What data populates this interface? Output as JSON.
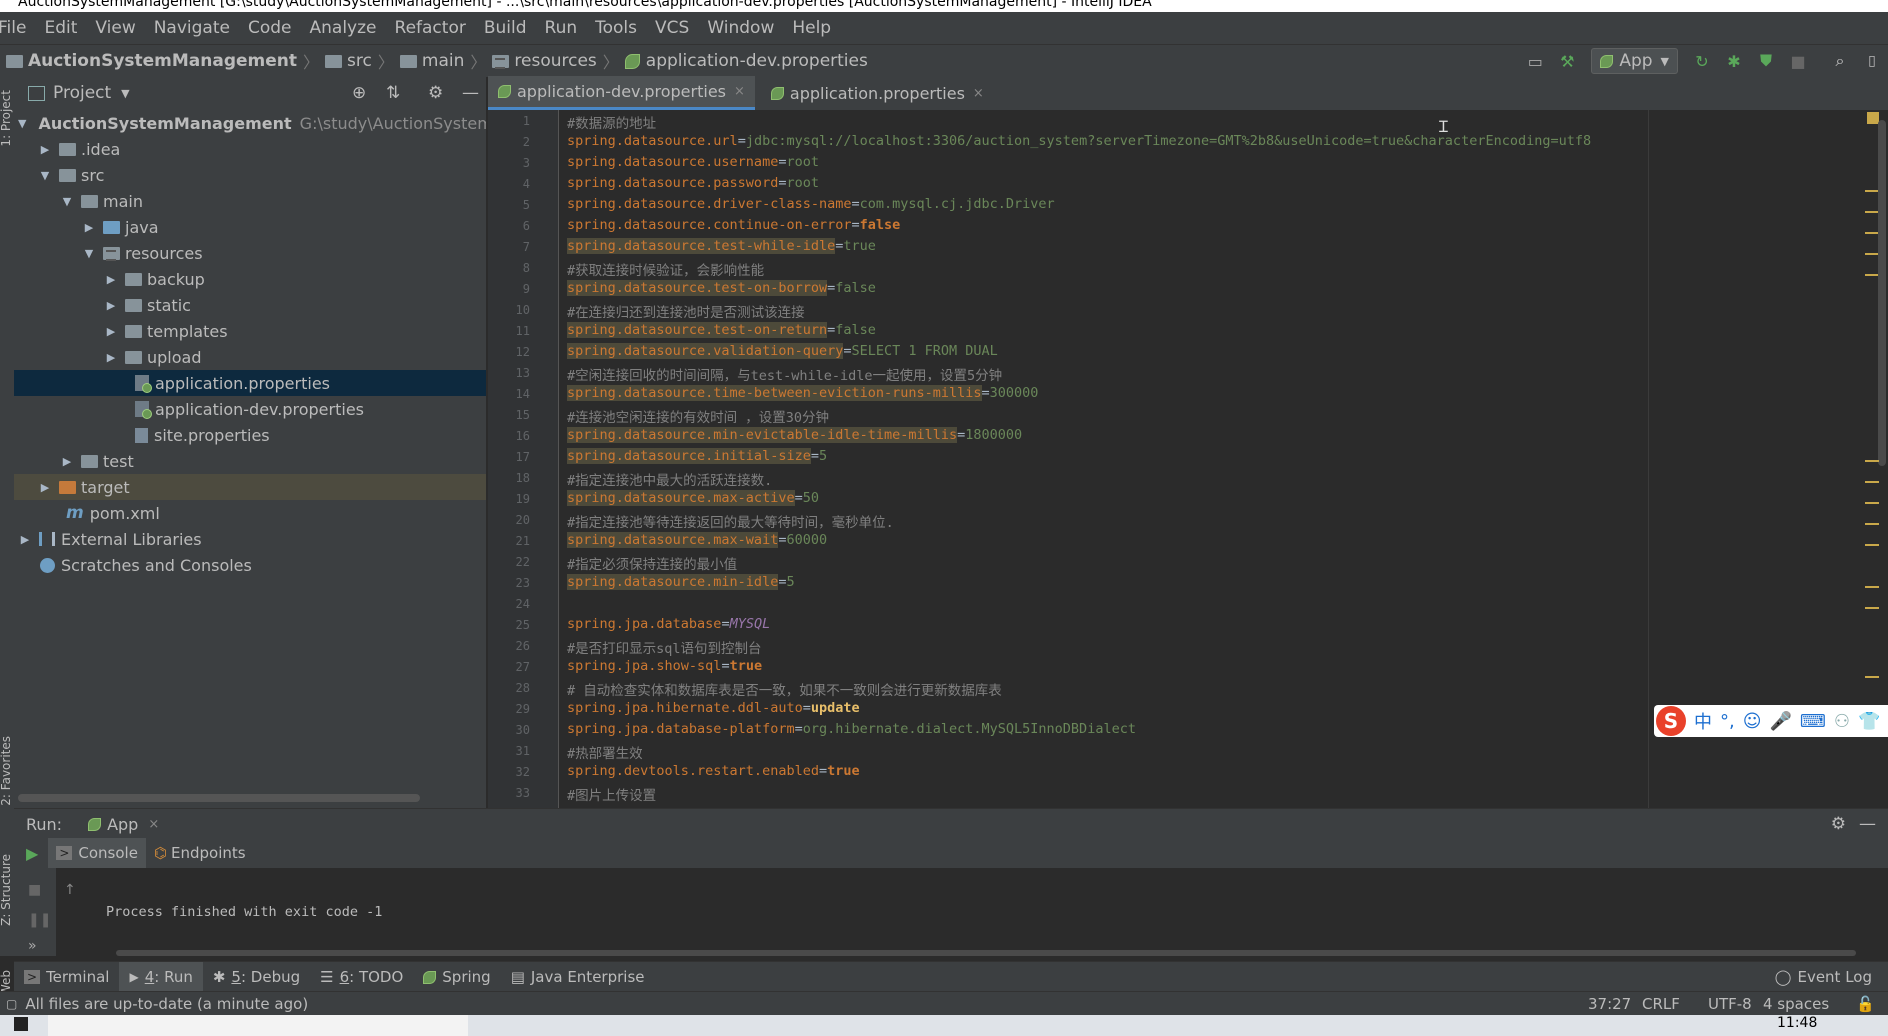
{
  "window": {
    "title": "AuctionSystemManagement [G:\\study\\AuctionSystemManagement] - ...\\src\\main\\resources\\application-dev.properties [AuctionSystemManagement] - IntelliJ IDEA"
  },
  "menu": [
    "File",
    "Edit",
    "View",
    "Navigate",
    "Code",
    "Analyze",
    "Refactor",
    "Build",
    "Run",
    "Tools",
    "VCS",
    "Window",
    "Help"
  ],
  "breadcrumbs": [
    "AuctionSystemManagement",
    "src",
    "main",
    "resources",
    "application-dev.properties"
  ],
  "toolbar": {
    "run_config": "App"
  },
  "left_stripe": {
    "project": "1: Project",
    "favorites": "2: Favorites",
    "structure": "Z: Structure",
    "web": "Web"
  },
  "project_panel": {
    "title": "Project",
    "tree": [
      {
        "label": "AuctionSystemManagement",
        "hint": "G:\\study\\AuctionSystemMa",
        "arrow": "▼"
      },
      {
        "label": ".idea",
        "arrow": "▶"
      },
      {
        "label": "src",
        "arrow": "▼"
      },
      {
        "label": "main",
        "arrow": "▼"
      },
      {
        "label": "java",
        "arrow": "▶"
      },
      {
        "label": "resources",
        "arrow": "▼"
      },
      {
        "label": "backup",
        "arrow": "▶"
      },
      {
        "label": "static",
        "arrow": "▶"
      },
      {
        "label": "templates",
        "arrow": "▶"
      },
      {
        "label": "upload",
        "arrow": "▶"
      },
      {
        "label": "application.properties",
        "arrow": ""
      },
      {
        "label": "application-dev.properties",
        "arrow": ""
      },
      {
        "label": "site.properties",
        "arrow": ""
      },
      {
        "label": "test",
        "arrow": "▶"
      },
      {
        "label": "target",
        "arrow": "▶"
      },
      {
        "label": "pom.xml",
        "arrow": ""
      },
      {
        "label": "External Libraries",
        "arrow": "▶"
      },
      {
        "label": "Scratches and Consoles",
        "arrow": ""
      }
    ]
  },
  "editor": {
    "tabs": [
      {
        "label": "application-dev.properties",
        "close": "×"
      },
      {
        "label": "application.properties",
        "close": "×"
      }
    ],
    "line_numbers": [
      "1",
      "2",
      "3",
      "4",
      "5",
      "6",
      "7",
      "8",
      "9",
      "10",
      "11",
      "12",
      "13",
      "14",
      "15",
      "16",
      "17",
      "18",
      "19",
      "20",
      "21",
      "22",
      "23",
      "24",
      "25",
      "26",
      "27",
      "28",
      "29",
      "30",
      "31",
      "32",
      "33"
    ],
    "lines": [
      {
        "k": "#数据源的地址",
        "v": ""
      },
      {
        "k": "spring.datasource.url",
        "v": "jdbc:mysql://localhost:3306/auction_system?serverTimezone=GMT%2b8&useUnicode=true&characterEncoding=utf8"
      },
      {
        "k": "spring.datasource.username",
        "v": "root"
      },
      {
        "k": "spring.datasource.password",
        "v": "root"
      },
      {
        "k": "spring.datasource.driver-class-name",
        "v": "com.mysql.cj.jdbc.Driver"
      },
      {
        "k": "spring.datasource.continue-on-error",
        "v": "false"
      },
      {
        "k": "spring.datasource.test-while-idle",
        "v": "true"
      },
      {
        "k": "#获取连接时候验证，会影响性能",
        "v": ""
      },
      {
        "k": "spring.datasource.test-on-borrow",
        "v": "false"
      },
      {
        "k": "#在连接归还到连接池时是否测试该连接",
        "v": ""
      },
      {
        "k": "spring.datasource.test-on-return",
        "v": "false"
      },
      {
        "k": "spring.datasource.validation-query",
        "v": "SELECT 1 FROM DUAL"
      },
      {
        "k": "#空闲连接回收的时间间隔，与test-while-idle一起使用，设置5分钟",
        "v": ""
      },
      {
        "k": "spring.datasource.time-between-eviction-runs-millis",
        "v": "300000"
      },
      {
        "k": "#连接池空闲连接的有效时间 ，设置30分钟",
        "v": ""
      },
      {
        "k": "spring.datasource.min-evictable-idle-time-millis",
        "v": "1800000"
      },
      {
        "k": "spring.datasource.initial-size",
        "v": "5"
      },
      {
        "k": "#指定连接池中最大的活跃连接数.",
        "v": ""
      },
      {
        "k": "spring.datasource.max-active",
        "v": "50"
      },
      {
        "k": "#指定连接池等待连接返回的最大等待时间，毫秒单位.",
        "v": ""
      },
      {
        "k": "spring.datasource.max-wait",
        "v": "60000"
      },
      {
        "k": "#指定必须保持连接的最小值",
        "v": ""
      },
      {
        "k": "spring.datasource.min-idle",
        "v": "5"
      },
      {
        "k": "",
        "v": ""
      },
      {
        "k": "spring.jpa.database",
        "v": "MYSQL"
      },
      {
        "k": "#是否打印显示sql语句到控制台",
        "v": ""
      },
      {
        "k": "spring.jpa.show-sql",
        "v": "true"
      },
      {
        "k": "# 自动检查实体和数据库表是否一致，如果不一致则会进行更新数据库表",
        "v": ""
      },
      {
        "k": "spring.jpa.hibernate.ddl-auto",
        "v": "update"
      },
      {
        "k": "spring.jpa.database-platform",
        "v": "org.hibernate.dialect.MySQL5InnoDBDialect"
      },
      {
        "k": "#热部署生效",
        "v": ""
      },
      {
        "k": "spring.devtools.restart.enabled",
        "v": "true"
      },
      {
        "k": "#图片上传设置",
        "v": ""
      }
    ]
  },
  "ime": {
    "logo": "S",
    "mode": "中",
    "punct": "°,"
  },
  "run_panel": {
    "label": "Run:",
    "config": "App",
    "tabs": [
      "Console",
      "Endpoints"
    ],
    "output": "Process finished with exit code -1"
  },
  "tool_tabs": [
    {
      "num": "",
      "label": "Terminal"
    },
    {
      "num": "4",
      "label": ": Run"
    },
    {
      "num": "5",
      "label": ": Debug"
    },
    {
      "num": "6",
      "label": ": TODO"
    },
    {
      "num": "",
      "label": "Spring"
    },
    {
      "num": "",
      "label": "Java Enterprise"
    }
  ],
  "event_log": "Event Log",
  "status": {
    "message": "All files are up-to-date (a minute ago)",
    "position": "37:27",
    "line_sep": "CRLF",
    "encoding": "UTF-8",
    "indent": "4 spaces"
  },
  "taskbar": {
    "clock": "11:48"
  },
  "colors": {
    "accent": "#4a88c7",
    "selection": "#0d293e",
    "keyword": "#cc7832",
    "string": "#6a8759",
    "comment": "#808080"
  }
}
